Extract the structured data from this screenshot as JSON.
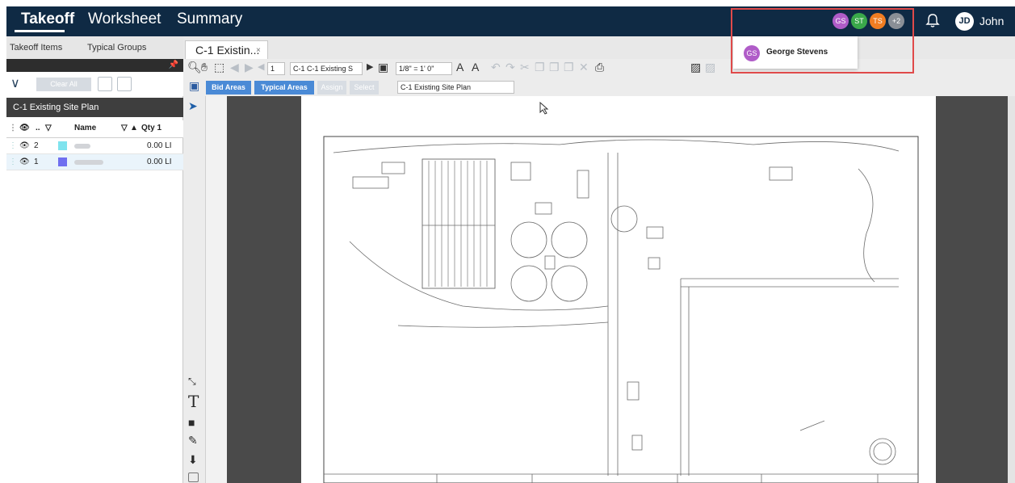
{
  "nav": {
    "takeoff": "Takeoff",
    "worksheet": "Worksheet",
    "summary": "Summary"
  },
  "presence": {
    "avatars": [
      {
        "initials": "GS",
        "color": "#b05cc8"
      },
      {
        "initials": "ST",
        "color": "#3aa84a"
      },
      {
        "initials": "TS",
        "color": "#ef7d22"
      },
      {
        "initials": "+2",
        "color": "#8a8f96"
      }
    ],
    "dropdown": {
      "initials": "GS",
      "name": "George Stevens"
    }
  },
  "user": {
    "initials": "JD",
    "name": "John"
  },
  "left_panel": {
    "tabs": [
      "Takeoff Items",
      "Typical Groups"
    ],
    "clear_all": "Clear All",
    "plan_title": "C-1 Existing Site Plan",
    "columns": {
      "count": "..",
      "name": "Name",
      "qty": "Qty 1"
    },
    "rows": [
      {
        "num": "2",
        "color": "#7fe3ee",
        "qty": "0.00 LI"
      },
      {
        "num": "1",
        "color": "#6f6ff0",
        "qty": "0.00 LI"
      }
    ]
  },
  "doc_tab": {
    "label": "C-1 Existin...",
    "close": "×"
  },
  "toolbar": {
    "page_number": "1",
    "page_select": "C-1 C-1 Existing S",
    "scale_select": "1/8\" = 1' 0\"",
    "bid_areas": "Bid Areas",
    "typical_areas": "Typical Areas",
    "assign": "Assign",
    "select": "Select",
    "plan_select": "C-1 Existing Site Plan"
  },
  "colors": {
    "topbar": "#0f2a44",
    "accent_blue": "#4a8ad6",
    "highlight": "#e04a4a"
  }
}
